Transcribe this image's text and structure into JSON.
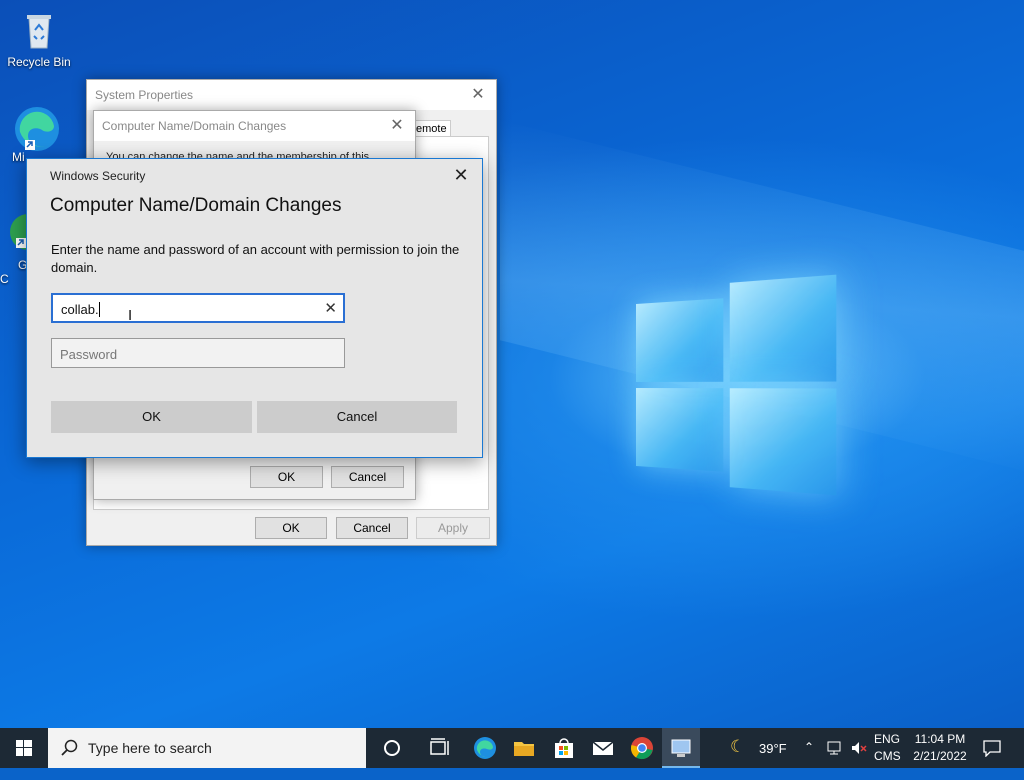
{
  "desktop": {
    "icons": [
      {
        "label": "Recycle Bin"
      },
      {
        "label": "Mi"
      },
      {
        "label": "G\nC"
      }
    ]
  },
  "system_properties": {
    "title": "System Properties",
    "tab_fragment": "emote",
    "ok_label": "OK",
    "cancel_label": "Cancel",
    "apply_label": "Apply"
  },
  "domain_changes": {
    "title": "Computer Name/Domain Changes",
    "body_fragment": "You can change the name and the membership of this",
    "ok_label": "OK",
    "cancel_label": "Cancel"
  },
  "security": {
    "window_title": "Windows Security",
    "heading": "Computer Name/Domain Changes",
    "message": "Enter the name and password of an account with permission to join the domain.",
    "username_value": "collab.",
    "password_placeholder": "Password",
    "ok_label": "OK",
    "cancel_label": "Cancel"
  },
  "taskbar": {
    "search_placeholder": "Type here to search",
    "weather": "39°F",
    "lang_top": "ENG",
    "lang_bottom": "CMS",
    "time": "11:04 PM",
    "date": "2/21/2022"
  },
  "colors": {
    "desktop_blue": "#0a63c9",
    "taskbar": "#1d2935",
    "accent": "#2a6fd3"
  }
}
